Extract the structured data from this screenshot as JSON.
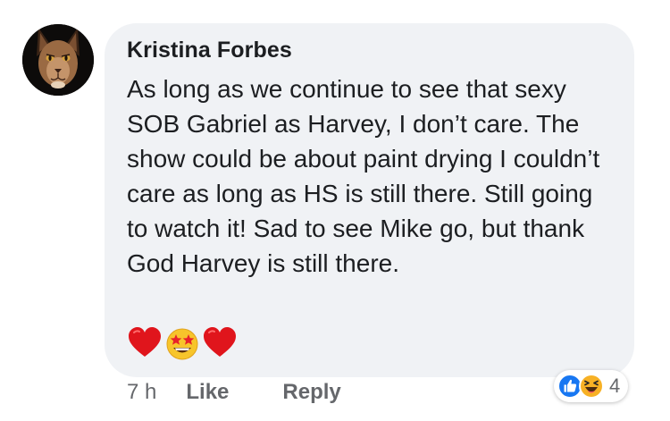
{
  "comment": {
    "author": "Kristina Forbes",
    "text": "As long as we continue to see that sexy SOB Gabriel as Harvey, I don’t care. The show could be about paint drying I couldn’t care as long as HS is still there. Still going to watch it! Sad to see Mike go, but thank God Harvey is still there.",
    "emojis": [
      "red-heart-icon",
      "star-struck-icon",
      "red-heart-icon"
    ]
  },
  "actions": {
    "timestamp": "7 h",
    "like_label": "Like",
    "reply_label": "Reply"
  },
  "reactions": {
    "icons": [
      "like-reaction-icon",
      "haha-reaction-icon"
    ],
    "count": "4"
  },
  "colors": {
    "bubble": "#f0f2f5",
    "text": "#1c1e21",
    "secondary_text": "#65676b",
    "like_blue": "#1877f2",
    "haha_yellow": "#f7b125",
    "heart_red": "#e0151c"
  }
}
